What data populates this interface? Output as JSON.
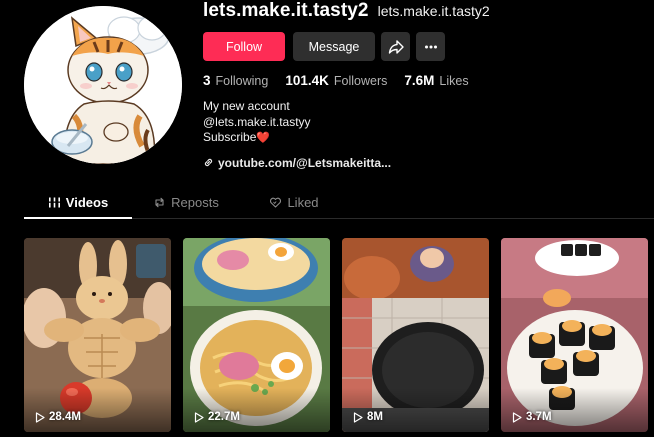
{
  "profile": {
    "username": "lets.make.it.tasty2",
    "display_name": "lets.make.it.tasty2",
    "avatar_icon": "cartoon-cat-chef-avatar"
  },
  "actions": {
    "follow_label": "Follow",
    "message_label": "Message",
    "share_icon": "share-icon",
    "more_icon": "more-icon"
  },
  "stats": {
    "following": "3",
    "following_label": "Following",
    "followers": "101.4K",
    "followers_label": "Followers",
    "likes": "7.6M",
    "likes_label": "Likes"
  },
  "bio": {
    "line1": "My new account",
    "line2": "@lets.make.it.tastyy",
    "line3": "Subscribe",
    "line3_emoji": "❤️"
  },
  "link": {
    "text": "youtube.com/@Letsmakeitta...",
    "icon": "link-icon"
  },
  "tabs": [
    {
      "label": "Videos",
      "icon": "grid-icon",
      "active": true
    },
    {
      "label": "Reposts",
      "icon": "repost-icon",
      "active": false
    },
    {
      "label": "Liked",
      "icon": "heart-outline-icon",
      "active": false
    }
  ],
  "videos": [
    {
      "views": "28.4M"
    },
    {
      "views": "22.7M"
    },
    {
      "views": "8M"
    },
    {
      "views": "3.7M"
    }
  ],
  "colors": {
    "accent": "#fe2c55",
    "background": "#000000",
    "button_dark": "#2f2f2f"
  }
}
